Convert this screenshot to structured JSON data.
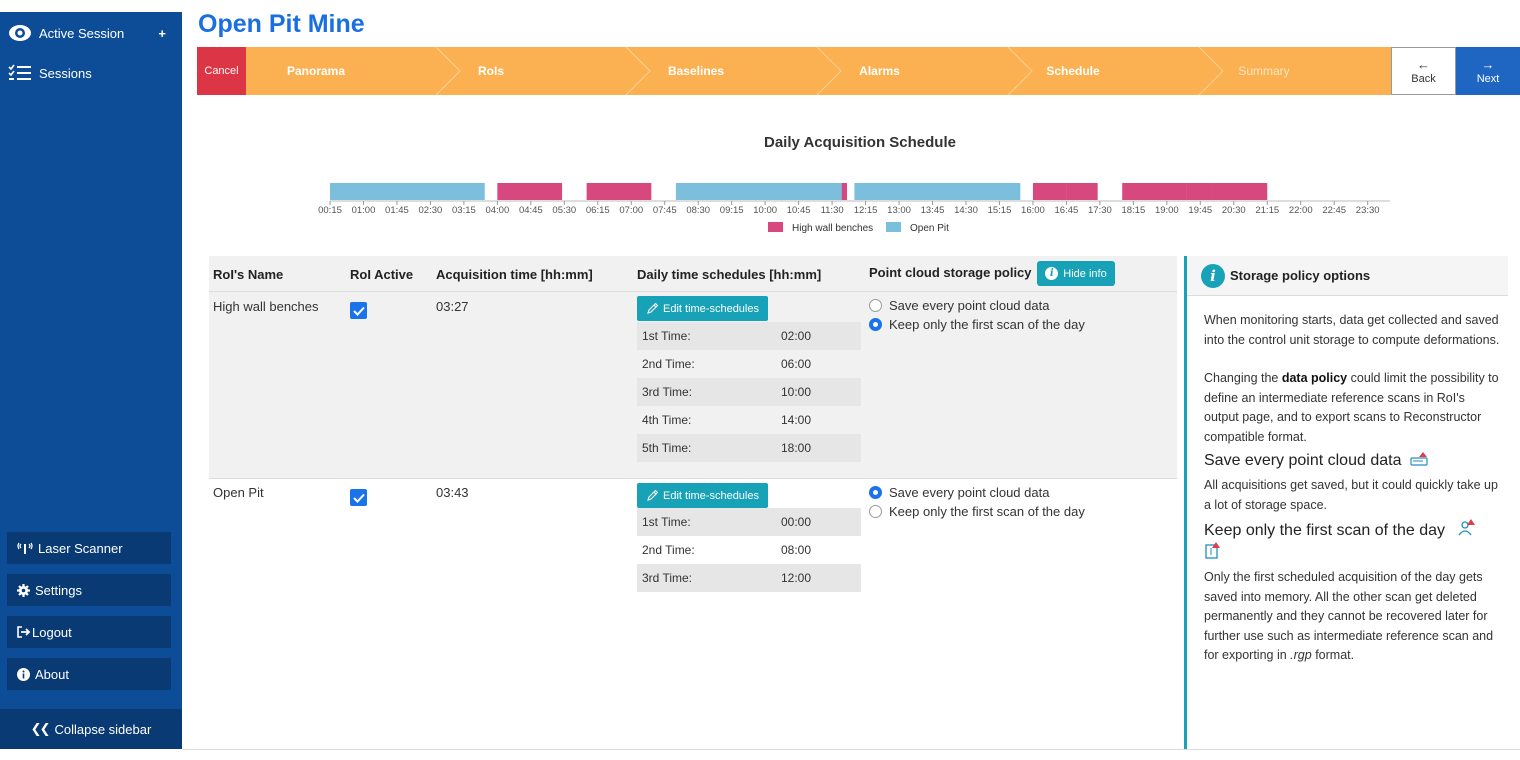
{
  "sidebar": {
    "active_session": "Active Session",
    "active_plus": "+",
    "sessions": "Sessions",
    "laser_scanner": "Laser Scanner",
    "settings": "Settings",
    "logout": "Logout",
    "about": "About",
    "collapse": "Collapse sidebar"
  },
  "page": {
    "title": "Open Pit Mine"
  },
  "wizard": {
    "cancel": "Cancel",
    "steps": [
      "Panorama",
      "RoIs",
      "Baselines",
      "Alarms",
      "Schedule",
      "Summary"
    ],
    "back": "Back",
    "next": "Next",
    "back_arrow": "←",
    "next_arrow": "→"
  },
  "chart_data": {
    "type": "timeline",
    "title": "Daily Acquisition Schedule",
    "ticks": [
      "00:15",
      "01:00",
      "01:45",
      "02:30",
      "03:15",
      "04:00",
      "04:45",
      "05:30",
      "06:15",
      "07:00",
      "07:45",
      "08:30",
      "09:15",
      "10:00",
      "10:45",
      "11:30",
      "12:15",
      "13:00",
      "13:45",
      "14:30",
      "15:15",
      "16:00",
      "16:45",
      "17:30",
      "18:15",
      "19:00",
      "19:45",
      "20:30",
      "21:15",
      "22:00",
      "22:45",
      "23:30"
    ],
    "x_range_hours": [
      0.25,
      24
    ],
    "series": [
      {
        "name": "High wall benches",
        "color": "#d6487e",
        "intervals": [
          [
            "04:00",
            "05:27"
          ],
          [
            "06:00",
            "07:27"
          ],
          [
            "10:00",
            "11:27"
          ],
          [
            "14:00",
            "15:27"
          ],
          [
            "18:00",
            "19:27"
          ],
          [
            "19:27",
            "20:00"
          ],
          [
            "20:00",
            "21:15"
          ],
          [
            "11:27",
            "11:50"
          ],
          [
            "16:00",
            "16:45"
          ],
          [
            "16:45",
            "17:27"
          ]
        ]
      },
      {
        "name": "Open Pit",
        "color": "#7bbfdd",
        "intervals": [
          [
            "00:00",
            "03:43"
          ],
          [
            "08:00",
            "11:43"
          ],
          [
            "12:00",
            "15:43"
          ]
        ]
      }
    ],
    "legend": "bottom-center"
  },
  "table": {
    "headers": [
      "RoI's Name",
      "RoI Active",
      "Acquisition time [hh:mm]",
      "Daily time schedules [hh:mm]",
      "Point cloud storage policy"
    ],
    "hide_info": "Hide info",
    "edit_label": "Edit time-schedules",
    "rows": [
      {
        "name": "High wall benches",
        "active": true,
        "acq_time": "03:27",
        "schedules": [
          {
            "label": "1st Time:",
            "value": "02:00"
          },
          {
            "label": "2nd Time:",
            "value": "06:00"
          },
          {
            "label": "3rd Time:",
            "value": "10:00"
          },
          {
            "label": "4th Time:",
            "value": "14:00"
          },
          {
            "label": "5th Time:",
            "value": "18:00"
          }
        ],
        "policy": "keep_first"
      },
      {
        "name": "Open Pit",
        "active": true,
        "acq_time": "03:43",
        "schedules": [
          {
            "label": "1st Time:",
            "value": "00:00"
          },
          {
            "label": "2nd Time:",
            "value": "08:00"
          },
          {
            "label": "3rd Time:",
            "value": "12:00"
          }
        ],
        "policy": "save_all"
      }
    ],
    "policy_options": [
      "Save every point cloud data",
      "Keep only the first scan of the day"
    ]
  },
  "info": {
    "title": "Storage policy options",
    "p1": "When monitoring starts, data get collected and saved into the control unit storage to compute deformations.",
    "p2_a": "Changing the ",
    "p2_b": "data policy",
    "p2_c": " could limit the possibility to define an intermediate reference scans in RoI's output page, and to export scans to Reconstructor compatible format.",
    "h1": "Save every point cloud data",
    "p3": "All acquisitions get saved, but it could quickly take up a lot of storage space.",
    "h2": "Keep only the first scan of the day",
    "p4": "Only the first scheduled acquisition of the day gets saved into memory. All the other scan get deleted permanently and they cannot be recovered later for further use such as intermediate reference scan and for exporting in ",
    "p4_em": ".rgp",
    "p4_end": " format."
  }
}
